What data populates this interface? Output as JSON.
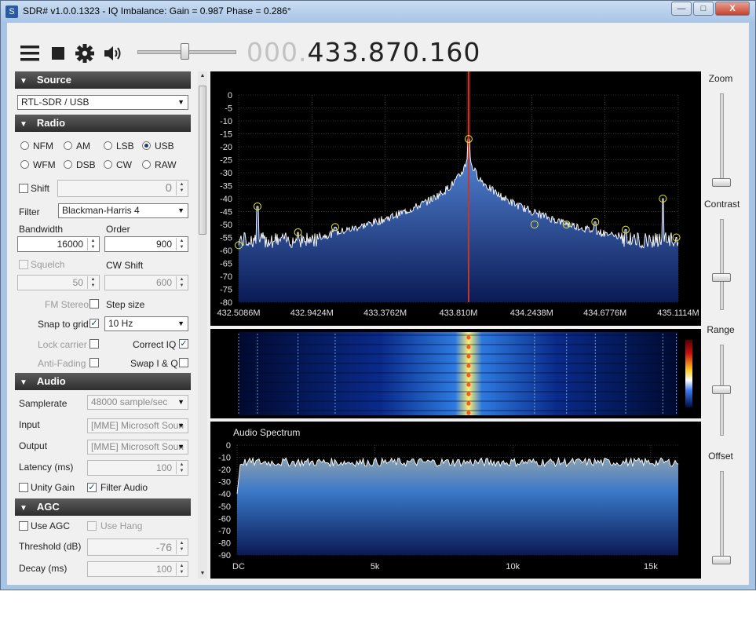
{
  "window": {
    "title": "SDR# v1.0.0.1323 - IQ Imbalance: Gain = 0.987 Phase = 0.286°",
    "minimize_label": "—",
    "maximize_label": "□",
    "close_label": "X"
  },
  "toolbar": {
    "menu_icon": "hamburger-icon",
    "stop_icon": "stop-icon",
    "settings_icon": "gear-icon",
    "audio_icon": "speaker-icon",
    "volume_fraction": 0.48,
    "frequency_prefix": "000.",
    "frequency_main": "433.870.160"
  },
  "panel": {
    "source": {
      "header": "Source",
      "device": "RTL-SDR / USB"
    },
    "radio": {
      "header": "Radio",
      "modes": [
        "NFM",
        "AM",
        "LSB",
        "USB",
        "WFM",
        "DSB",
        "CW",
        "RAW"
      ],
      "selected_mode": "USB",
      "shift_label": "Shift",
      "shift_value": "0",
      "filter_label": "Filter",
      "filter_value": "Blackman-Harris 4",
      "bandwidth_label": "Bandwidth",
      "bandwidth_value": "16000",
      "order_label": "Order",
      "order_value": "900",
      "squelch_label": "Squelch",
      "squelch_value": "50",
      "cwshift_label": "CW Shift",
      "cwshift_value": "600",
      "fmstereo_label": "FM Stereo",
      "stepsize_label": "Step size",
      "snap_label": "Snap to grid",
      "snap_checked": true,
      "step_value": "10 Hz",
      "lockcarrier_label": "Lock carrier",
      "correctiq_label": "Correct IQ",
      "correctiq_checked": true,
      "antifading_label": "Anti-Fading",
      "swapiq_label": "Swap I & Q"
    },
    "audio": {
      "header": "Audio",
      "samplerate_label": "Samplerate",
      "samplerate_value": "48000 sample/sec",
      "input_label": "Input",
      "input_value": "[MME] Microsoft Soun",
      "output_label": "Output",
      "output_value": "[MME] Microsoft Soun",
      "latency_label": "Latency (ms)",
      "latency_value": "100",
      "unitygain_label": "Unity Gain",
      "filteraudio_label": "Filter Audio",
      "filteraudio_checked": true
    },
    "agc": {
      "header": "AGC",
      "useagc_label": "Use AGC",
      "usehang_label": "Use Hang",
      "threshold_label": "Threshold (dB)",
      "threshold_value": "-76",
      "decay_label": "Decay (ms)",
      "decay_value": "100"
    }
  },
  "right_sliders": {
    "zoom_label": "Zoom",
    "contrast_label": "Contrast",
    "range_label": "Range",
    "offset_label": "Offset",
    "zoom_level": 0.0,
    "contrast_level": 0.35,
    "range_level": 0.5,
    "offset_level": 0.0
  },
  "colors": {
    "spectrum_fill_top": "#5a8ee0",
    "spectrum_fill_bottom": "#0a1a55",
    "peak_marker": "#e6e62a",
    "tuning_line": "#c0392b",
    "grid": "#5a5a5a"
  },
  "chart_data": [
    {
      "type": "area",
      "x_unit": "MHz",
      "y_tick_labels": [
        "0",
        "-5",
        "-10",
        "-15",
        "-20",
        "-25",
        "-30",
        "-35",
        "-40",
        "-45",
        "-50",
        "-55",
        "-60",
        "-65",
        "-70",
        "-75",
        "-80"
      ],
      "x_tick_labels": [
        "432.5086M",
        "432.9424M",
        "433.3762M",
        "433.810M",
        "434.2438M",
        "434.6776M",
        "435.1114M"
      ],
      "ylim": [
        -80,
        0
      ],
      "xlim": [
        432.5086,
        435.1114
      ],
      "tuned_frequency": 433.87,
      "noise_floor": -56,
      "peaks": [
        {
          "x": 432.5086,
          "y": -58
        },
        {
          "x": 432.62,
          "y": -43
        },
        {
          "x": 432.86,
          "y": -53
        },
        {
          "x": 433.08,
          "y": -51
        },
        {
          "x": 433.87,
          "y": -17
        },
        {
          "x": 434.26,
          "y": -50
        },
        {
          "x": 434.45,
          "y": -50
        },
        {
          "x": 434.62,
          "y": -49
        },
        {
          "x": 434.8,
          "y": -52
        },
        {
          "x": 435.02,
          "y": -40
        },
        {
          "x": 435.1,
          "y": -55
        }
      ],
      "grid": true
    },
    {
      "type": "area",
      "title": "Audio Spectrum",
      "y_tick_labels": [
        "0",
        "-10",
        "-20",
        "-30",
        "-40",
        "-50",
        "-60",
        "-70",
        "-80",
        "-90"
      ],
      "x_tick_labels": [
        "DC",
        "5k",
        "10k",
        "15k"
      ],
      "ylim": [
        -90,
        0
      ],
      "xlim": [
        0,
        16000
      ],
      "level": -10,
      "grid": true
    }
  ]
}
